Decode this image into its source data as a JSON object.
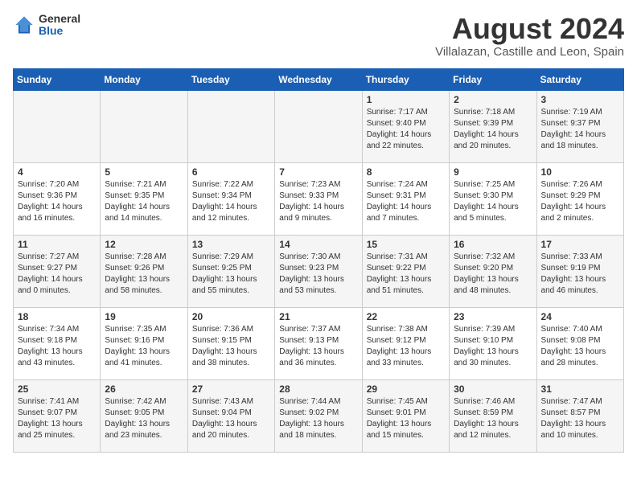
{
  "logo": {
    "general": "General",
    "blue": "Blue"
  },
  "title": {
    "month_year": "August 2024",
    "location": "Villalazan, Castille and Leon, Spain"
  },
  "headers": [
    "Sunday",
    "Monday",
    "Tuesday",
    "Wednesday",
    "Thursday",
    "Friday",
    "Saturday"
  ],
  "weeks": [
    [
      {
        "day": "",
        "info": ""
      },
      {
        "day": "",
        "info": ""
      },
      {
        "day": "",
        "info": ""
      },
      {
        "day": "",
        "info": ""
      },
      {
        "day": "1",
        "info": "Sunrise: 7:17 AM\nSunset: 9:40 PM\nDaylight: 14 hours\nand 22 minutes."
      },
      {
        "day": "2",
        "info": "Sunrise: 7:18 AM\nSunset: 9:39 PM\nDaylight: 14 hours\nand 20 minutes."
      },
      {
        "day": "3",
        "info": "Sunrise: 7:19 AM\nSunset: 9:37 PM\nDaylight: 14 hours\nand 18 minutes."
      }
    ],
    [
      {
        "day": "4",
        "info": "Sunrise: 7:20 AM\nSunset: 9:36 PM\nDaylight: 14 hours\nand 16 minutes."
      },
      {
        "day": "5",
        "info": "Sunrise: 7:21 AM\nSunset: 9:35 PM\nDaylight: 14 hours\nand 14 minutes."
      },
      {
        "day": "6",
        "info": "Sunrise: 7:22 AM\nSunset: 9:34 PM\nDaylight: 14 hours\nand 12 minutes."
      },
      {
        "day": "7",
        "info": "Sunrise: 7:23 AM\nSunset: 9:33 PM\nDaylight: 14 hours\nand 9 minutes."
      },
      {
        "day": "8",
        "info": "Sunrise: 7:24 AM\nSunset: 9:31 PM\nDaylight: 14 hours\nand 7 minutes."
      },
      {
        "day": "9",
        "info": "Sunrise: 7:25 AM\nSunset: 9:30 PM\nDaylight: 14 hours\nand 5 minutes."
      },
      {
        "day": "10",
        "info": "Sunrise: 7:26 AM\nSunset: 9:29 PM\nDaylight: 14 hours\nand 2 minutes."
      }
    ],
    [
      {
        "day": "11",
        "info": "Sunrise: 7:27 AM\nSunset: 9:27 PM\nDaylight: 14 hours\nand 0 minutes."
      },
      {
        "day": "12",
        "info": "Sunrise: 7:28 AM\nSunset: 9:26 PM\nDaylight: 13 hours\nand 58 minutes."
      },
      {
        "day": "13",
        "info": "Sunrise: 7:29 AM\nSunset: 9:25 PM\nDaylight: 13 hours\nand 55 minutes."
      },
      {
        "day": "14",
        "info": "Sunrise: 7:30 AM\nSunset: 9:23 PM\nDaylight: 13 hours\nand 53 minutes."
      },
      {
        "day": "15",
        "info": "Sunrise: 7:31 AM\nSunset: 9:22 PM\nDaylight: 13 hours\nand 51 minutes."
      },
      {
        "day": "16",
        "info": "Sunrise: 7:32 AM\nSunset: 9:20 PM\nDaylight: 13 hours\nand 48 minutes."
      },
      {
        "day": "17",
        "info": "Sunrise: 7:33 AM\nSunset: 9:19 PM\nDaylight: 13 hours\nand 46 minutes."
      }
    ],
    [
      {
        "day": "18",
        "info": "Sunrise: 7:34 AM\nSunset: 9:18 PM\nDaylight: 13 hours\nand 43 minutes."
      },
      {
        "day": "19",
        "info": "Sunrise: 7:35 AM\nSunset: 9:16 PM\nDaylight: 13 hours\nand 41 minutes."
      },
      {
        "day": "20",
        "info": "Sunrise: 7:36 AM\nSunset: 9:15 PM\nDaylight: 13 hours\nand 38 minutes."
      },
      {
        "day": "21",
        "info": "Sunrise: 7:37 AM\nSunset: 9:13 PM\nDaylight: 13 hours\nand 36 minutes."
      },
      {
        "day": "22",
        "info": "Sunrise: 7:38 AM\nSunset: 9:12 PM\nDaylight: 13 hours\nand 33 minutes."
      },
      {
        "day": "23",
        "info": "Sunrise: 7:39 AM\nSunset: 9:10 PM\nDaylight: 13 hours\nand 30 minutes."
      },
      {
        "day": "24",
        "info": "Sunrise: 7:40 AM\nSunset: 9:08 PM\nDaylight: 13 hours\nand 28 minutes."
      }
    ],
    [
      {
        "day": "25",
        "info": "Sunrise: 7:41 AM\nSunset: 9:07 PM\nDaylight: 13 hours\nand 25 minutes."
      },
      {
        "day": "26",
        "info": "Sunrise: 7:42 AM\nSunset: 9:05 PM\nDaylight: 13 hours\nand 23 minutes."
      },
      {
        "day": "27",
        "info": "Sunrise: 7:43 AM\nSunset: 9:04 PM\nDaylight: 13 hours\nand 20 minutes."
      },
      {
        "day": "28",
        "info": "Sunrise: 7:44 AM\nSunset: 9:02 PM\nDaylight: 13 hours\nand 18 minutes."
      },
      {
        "day": "29",
        "info": "Sunrise: 7:45 AM\nSunset: 9:01 PM\nDaylight: 13 hours\nand 15 minutes."
      },
      {
        "day": "30",
        "info": "Sunrise: 7:46 AM\nSunset: 8:59 PM\nDaylight: 13 hours\nand 12 minutes."
      },
      {
        "day": "31",
        "info": "Sunrise: 7:47 AM\nSunset: 8:57 PM\nDaylight: 13 hours\nand 10 minutes."
      }
    ]
  ]
}
